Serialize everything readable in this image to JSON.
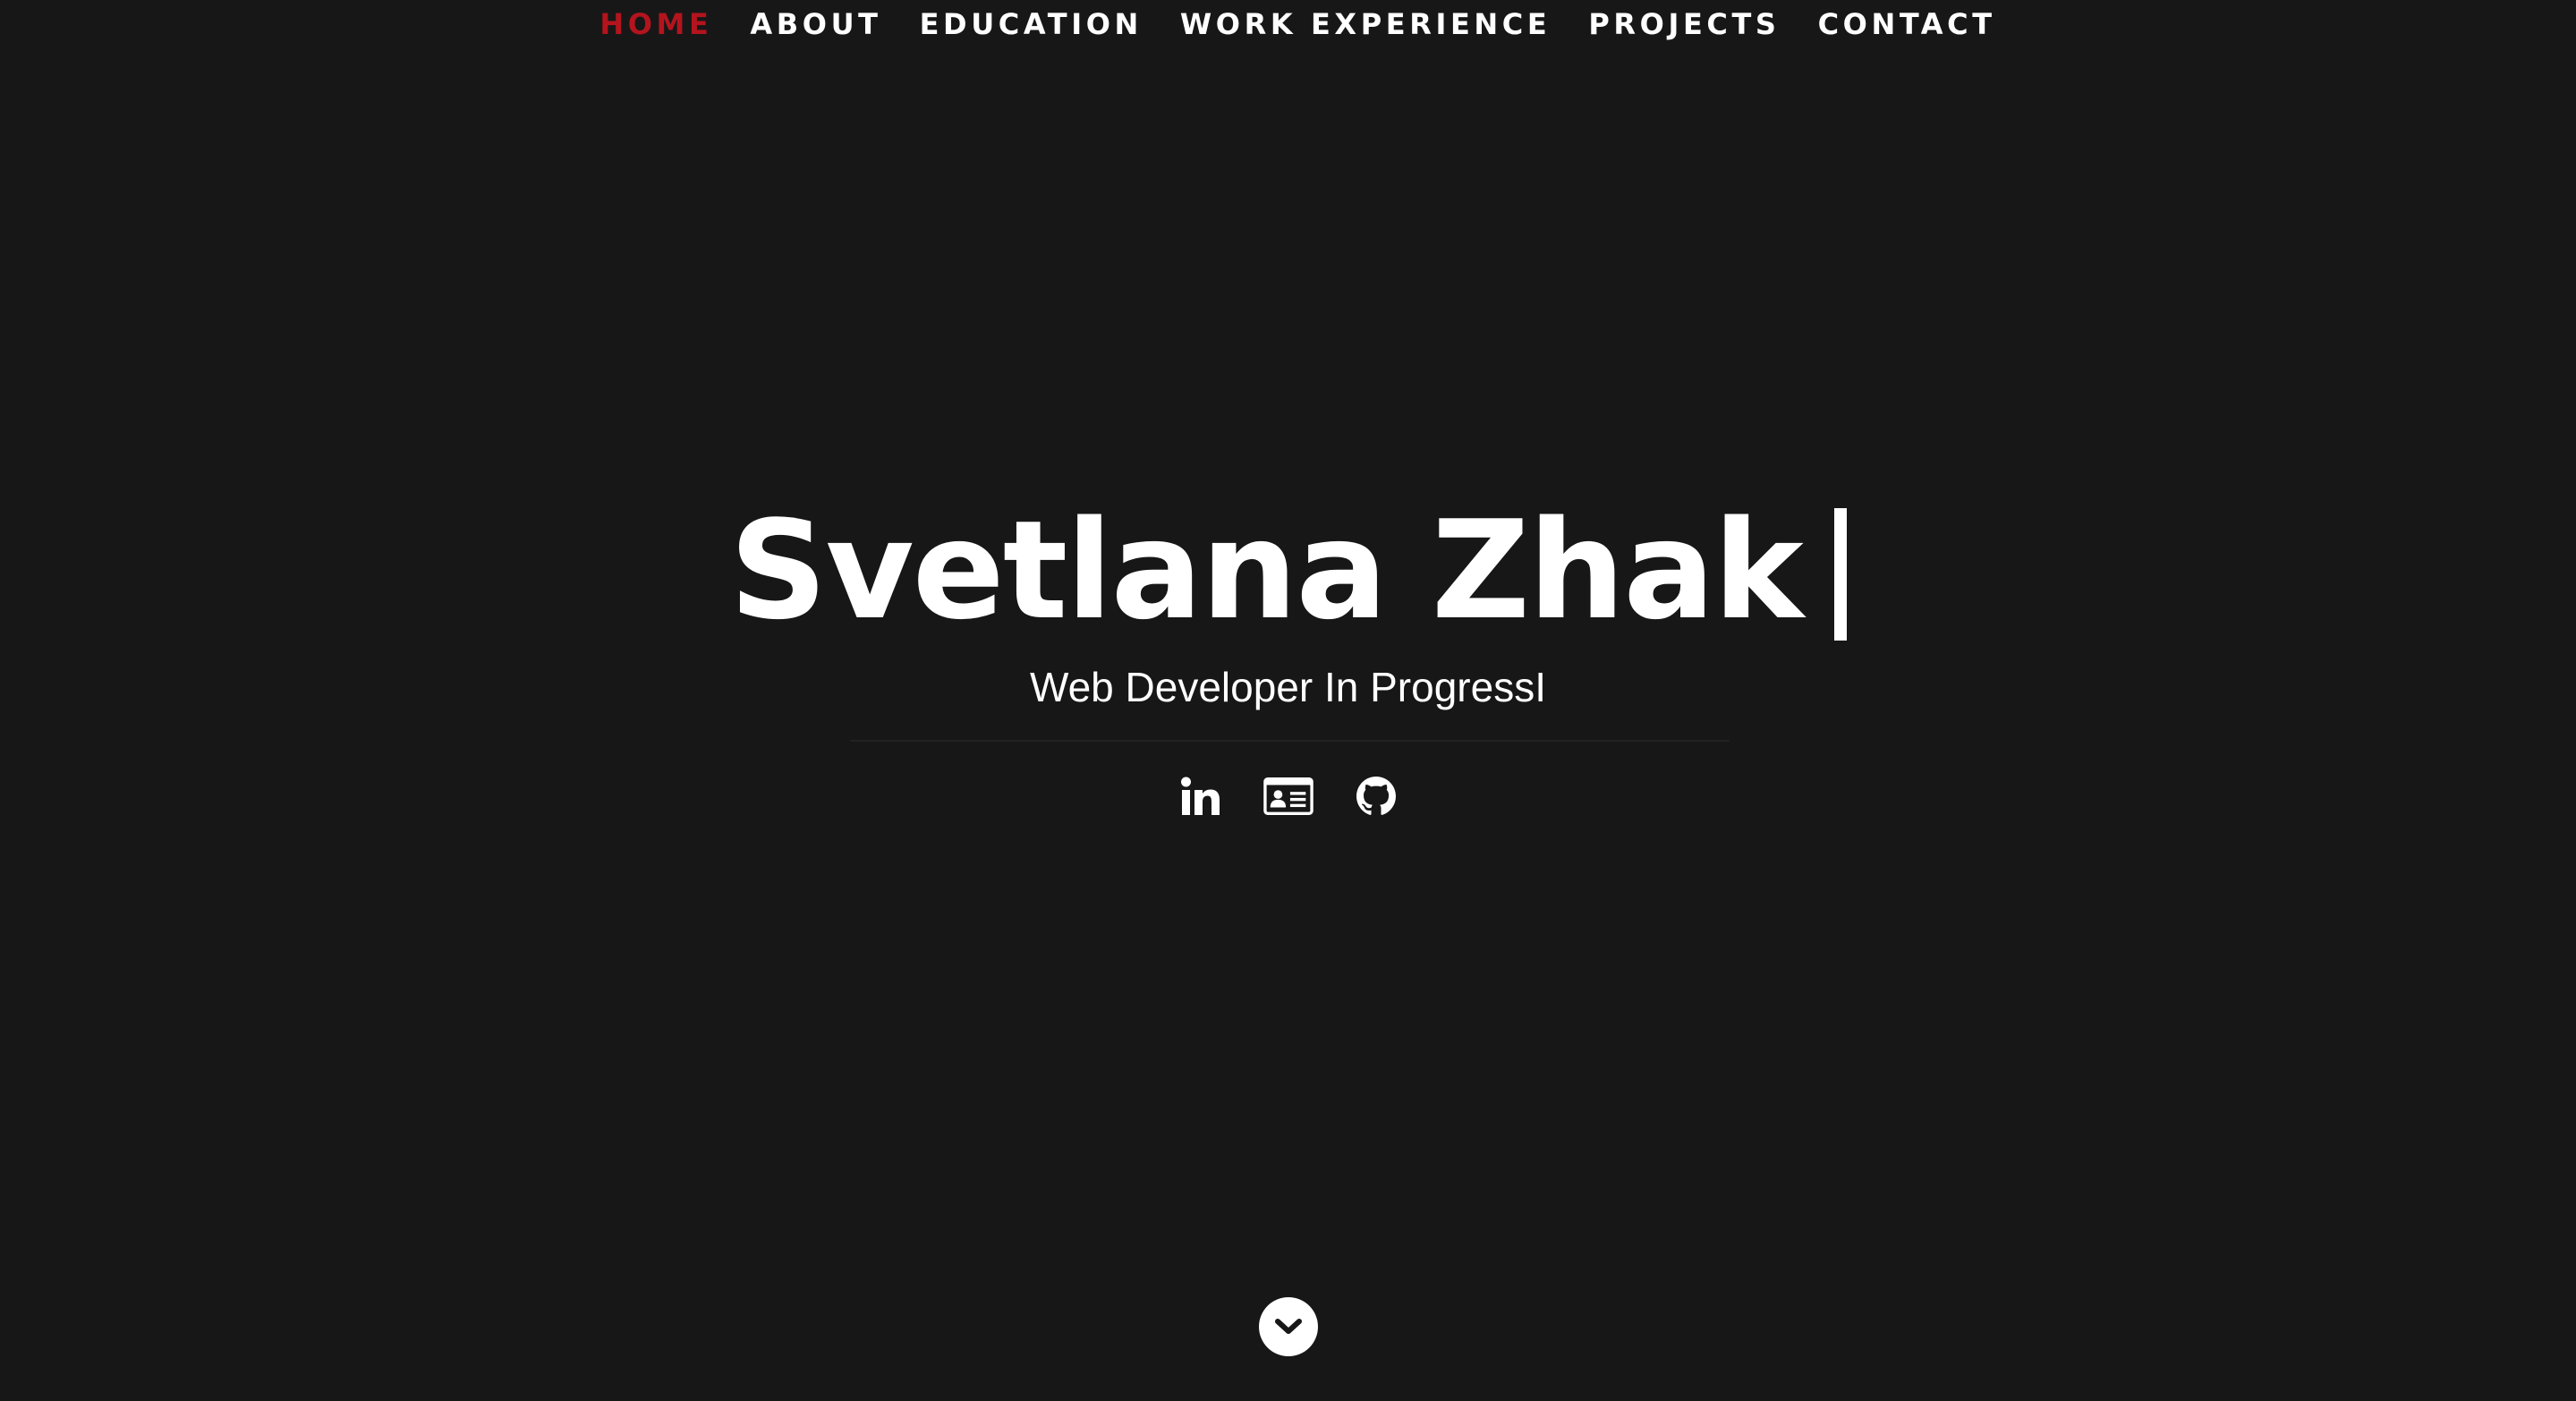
{
  "nav": {
    "items": [
      {
        "label": "HOME",
        "active": true
      },
      {
        "label": "ABOUT",
        "active": false
      },
      {
        "label": "EDUCATION",
        "active": false
      },
      {
        "label": "WORK EXPERIENCE",
        "active": false
      },
      {
        "label": "PROJECTS",
        "active": false
      },
      {
        "label": "CONTACT",
        "active": false
      }
    ]
  },
  "hero": {
    "name": "Svetlana Zhak",
    "subtitle": "Web Developer In ProgressI"
  },
  "socials": [
    {
      "icon": "linkedin-icon"
    },
    {
      "icon": "id-card-icon"
    },
    {
      "icon": "github-icon"
    }
  ],
  "scroll": {
    "icon": "chevron-down-icon"
  },
  "colors": {
    "background": "#181718",
    "accent": "#b3141e",
    "text": "#ffffff"
  }
}
